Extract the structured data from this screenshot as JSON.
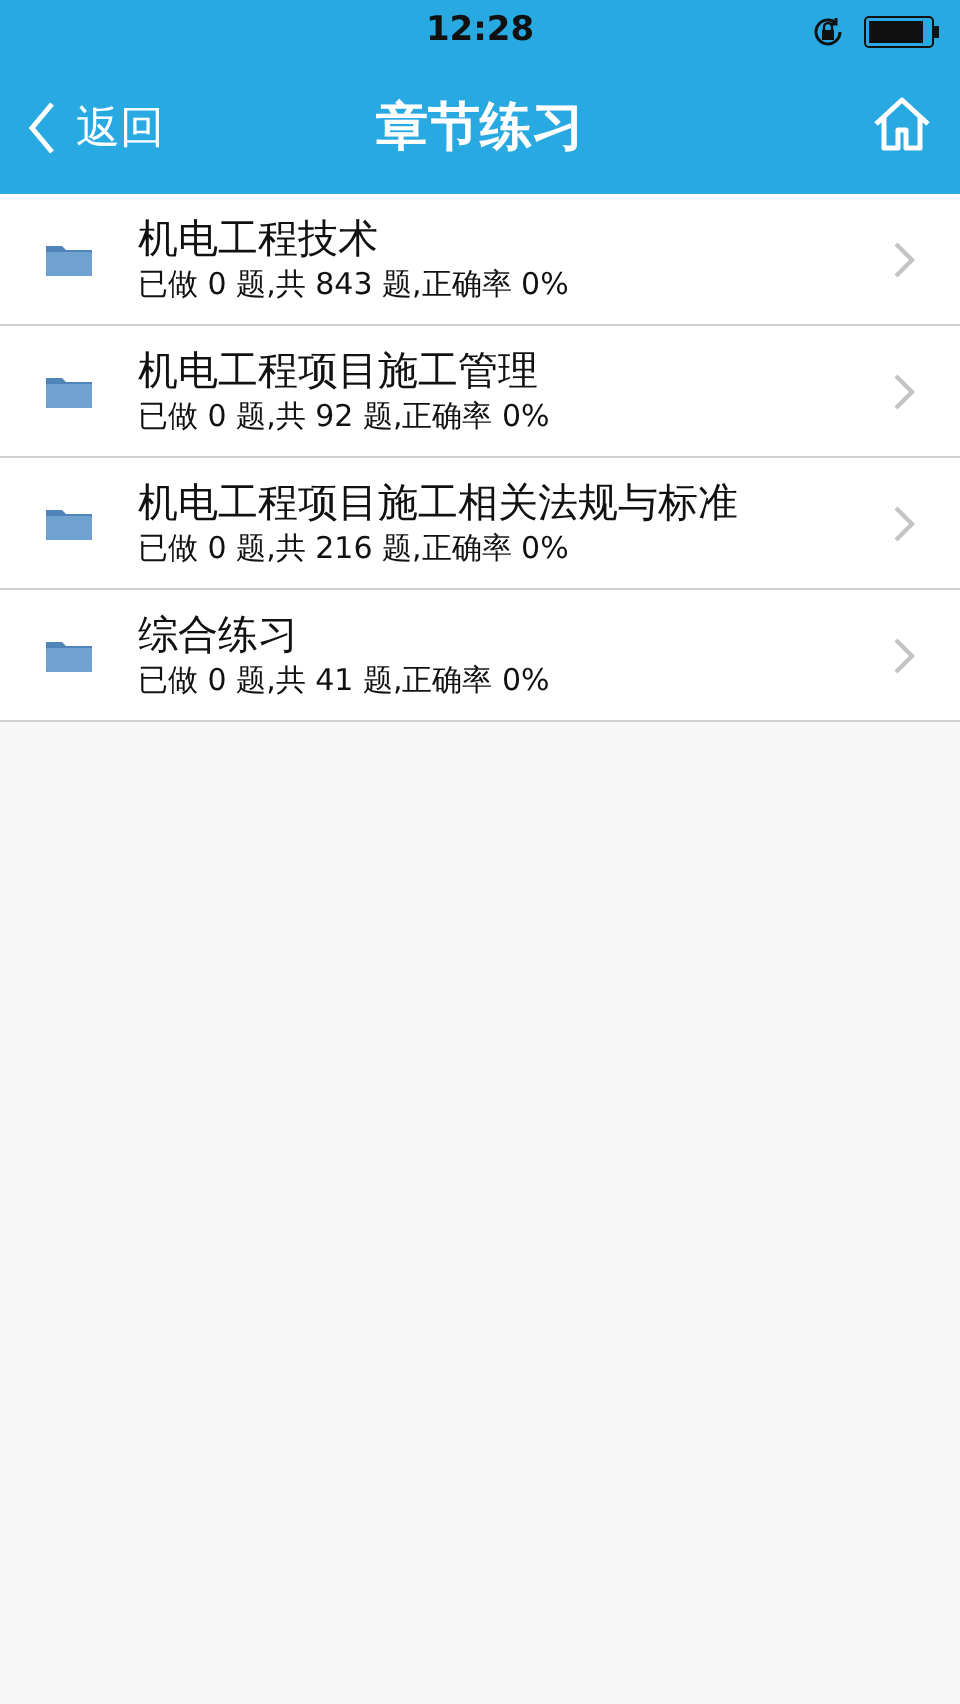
{
  "status_bar": {
    "time": "12:28"
  },
  "nav_bar": {
    "back": "返回",
    "title": "章节练习"
  },
  "chapters": [
    {
      "title": "机电工程技术",
      "stats": "已做 0 题,共 843 题,正确率 0%"
    },
    {
      "title": "机电工程项目施工管理",
      "stats": "已做 0 题,共 92 题,正确率 0%"
    },
    {
      "title": "机电工程项目施工相关法规与标准",
      "stats": "已做 0 题,共 216 题,正确率 0%"
    },
    {
      "title": "综合练习",
      "stats": "已做 0 题,共 41 题,正确率 0%"
    }
  ]
}
